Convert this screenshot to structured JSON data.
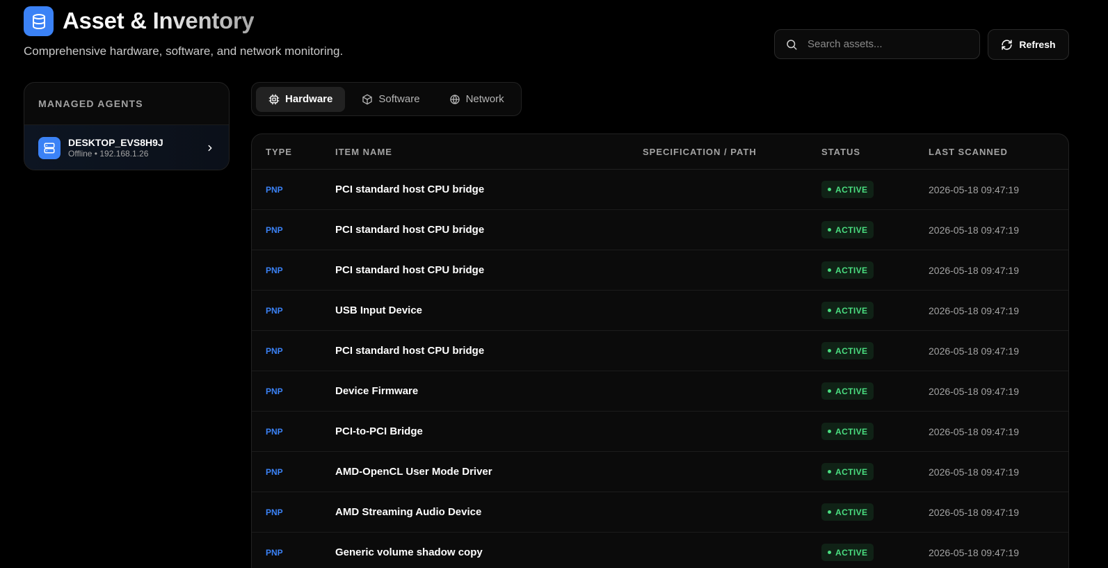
{
  "header": {
    "title": "Asset & Inventory",
    "subtitle": "Comprehensive hardware, software, and network monitoring.",
    "logo_icon": "database-icon"
  },
  "search": {
    "placeholder": "Search assets...",
    "value": ""
  },
  "refresh": {
    "label": "Refresh"
  },
  "sidebar": {
    "heading": "MANAGED AGENTS",
    "agents": [
      {
        "name": "DESKTOP_EVS8H9J",
        "meta": "Offline • 192.168.1.26"
      }
    ]
  },
  "tabs": [
    {
      "label": "Hardware",
      "icon": "cpu-icon",
      "active": true
    },
    {
      "label": "Software",
      "icon": "package-icon",
      "active": false
    },
    {
      "label": "Network",
      "icon": "globe-icon",
      "active": false
    }
  ],
  "table": {
    "columns": [
      "TYPE",
      "ITEM NAME",
      "SPECIFICATION / PATH",
      "STATUS",
      "LAST SCANNED"
    ],
    "rows": [
      {
        "type": "PNP",
        "name": "PCI standard host CPU bridge",
        "spec": "",
        "status": "ACTIVE",
        "last": "2026-05-18 09:47:19"
      },
      {
        "type": "PNP",
        "name": "PCI standard host CPU bridge",
        "spec": "",
        "status": "ACTIVE",
        "last": "2026-05-18 09:47:19"
      },
      {
        "type": "PNP",
        "name": "PCI standard host CPU bridge",
        "spec": "",
        "status": "ACTIVE",
        "last": "2026-05-18 09:47:19"
      },
      {
        "type": "PNP",
        "name": "USB Input Device",
        "spec": "",
        "status": "ACTIVE",
        "last": "2026-05-18 09:47:19"
      },
      {
        "type": "PNP",
        "name": "PCI standard host CPU bridge",
        "spec": "",
        "status": "ACTIVE",
        "last": "2026-05-18 09:47:19"
      },
      {
        "type": "PNP",
        "name": "Device Firmware",
        "spec": "",
        "status": "ACTIVE",
        "last": "2026-05-18 09:47:19"
      },
      {
        "type": "PNP",
        "name": "PCI-to-PCI Bridge",
        "spec": "",
        "status": "ACTIVE",
        "last": "2026-05-18 09:47:19"
      },
      {
        "type": "PNP",
        "name": "AMD-OpenCL User Mode Driver",
        "spec": "",
        "status": "ACTIVE",
        "last": "2026-05-18 09:47:19"
      },
      {
        "type": "PNP",
        "name": "AMD Streaming Audio Device",
        "spec": "",
        "status": "ACTIVE",
        "last": "2026-05-18 09:47:19"
      },
      {
        "type": "PNP",
        "name": "Generic volume shadow copy",
        "spec": "",
        "status": "ACTIVE",
        "last": "2026-05-18 09:47:19"
      }
    ]
  },
  "colors": {
    "accent": "#3b82f6",
    "active_green": "#4ade80",
    "background": "#000000"
  }
}
